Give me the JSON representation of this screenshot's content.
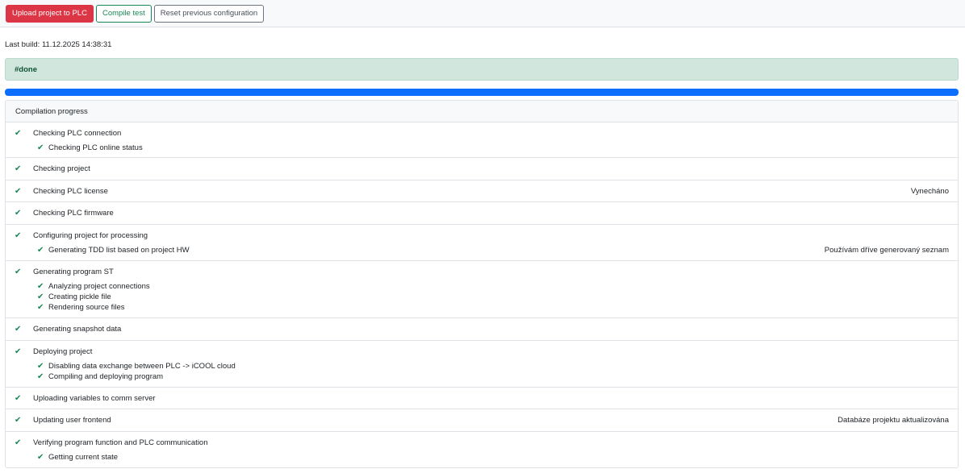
{
  "toolbar": {
    "upload_label": "Upload project to PLC",
    "compile_label": "Compile test",
    "reset_label": "Reset previous configuration"
  },
  "last_build": "Last build: 11.12.2025 14:38:31",
  "alert_text": "#done",
  "progress_value": 1.0,
  "card": {
    "title": "Compilation progress",
    "steps": [
      {
        "label": "Checking PLC connection",
        "note": "",
        "subs": [
          "Checking PLC online status"
        ]
      },
      {
        "label": "Checking project",
        "note": "",
        "subs": []
      },
      {
        "label": "Checking PLC license",
        "note": "Vynecháno",
        "subs": []
      },
      {
        "label": "Checking PLC firmware",
        "note": "",
        "subs": []
      },
      {
        "label": "Configuring project for processing",
        "note": "",
        "subs": [
          "Generating TDD list based on project HW"
        ],
        "sub_notes": [
          "Používám dříve generovaný seznam"
        ]
      },
      {
        "label": "Generating program ST",
        "note": "",
        "subs": [
          "Analyzing project connections",
          "Creating pickle file",
          "Rendering source files"
        ]
      },
      {
        "label": "Generating snapshot data",
        "note": "",
        "subs": []
      },
      {
        "label": "Deploying project",
        "note": "",
        "subs": [
          "Disabling data exchange between PLC -> iCOOL cloud",
          "Compiling and deploying program"
        ]
      },
      {
        "label": "Uploading variables to comm server",
        "note": "",
        "subs": []
      },
      {
        "label": "Updating user frontend",
        "note": "Databáze projektu aktualizována",
        "subs": []
      },
      {
        "label": "Verifying program function and PLC communication",
        "note": "",
        "subs": [
          "Getting current state"
        ]
      }
    ]
  },
  "icons": {
    "check": "check-icon"
  },
  "colors": {
    "danger": "#dc3545",
    "success": "#198754",
    "primary": "#0d6efd",
    "alert_bg": "#d1e7dd"
  }
}
